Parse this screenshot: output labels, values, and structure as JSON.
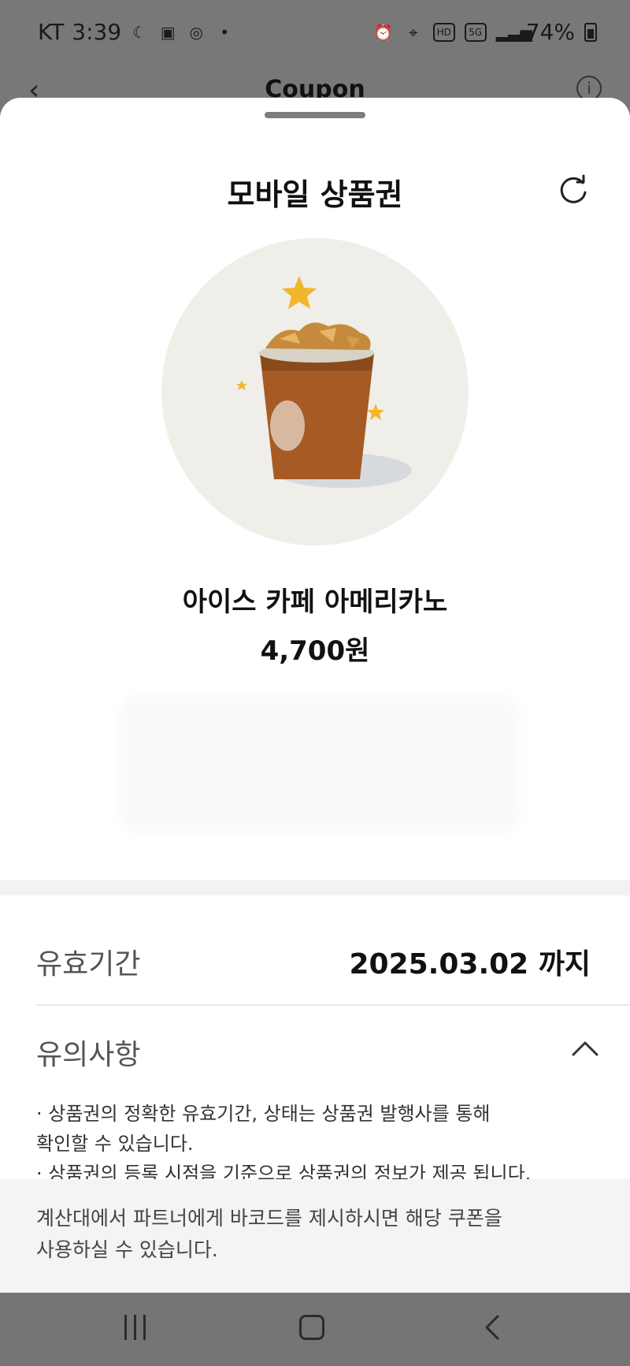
{
  "status_bar": {
    "carrier": "KT",
    "time": "3:39",
    "network": "5G",
    "battery_percent": "74%",
    "hd_label": "HD"
  },
  "header": {
    "title": "Coupon"
  },
  "sheet": {
    "title": "모바일 상품권",
    "product_name": "아이스 카페 아메리카노",
    "price": "4,700원",
    "validity_label": "유효기간",
    "validity_value": "2025.03.02 까지",
    "notice_label": "유의사항",
    "notices": [
      "· 상품권의 정확한 유효기간, 상태는 상품권 발행사를 통해",
      "확인할 수 있습니다.",
      "· 상품권의 등록 시점을 기준으로 상품권의 정보가 제공 됩니다."
    ],
    "footer_line1": "계산대에서 파트너에게 바코드를 제시하시면 해당 쿠폰을",
    "footer_line2": "사용하실 수 있습니다."
  },
  "colors": {
    "star": "#f3b52c",
    "cup": "#a65a24",
    "circle_bg": "#efeee9"
  },
  "icons": {
    "back": "chevron-left-icon",
    "info": "info-icon",
    "refresh": "refresh-icon",
    "collapse": "chevron-up-icon"
  }
}
